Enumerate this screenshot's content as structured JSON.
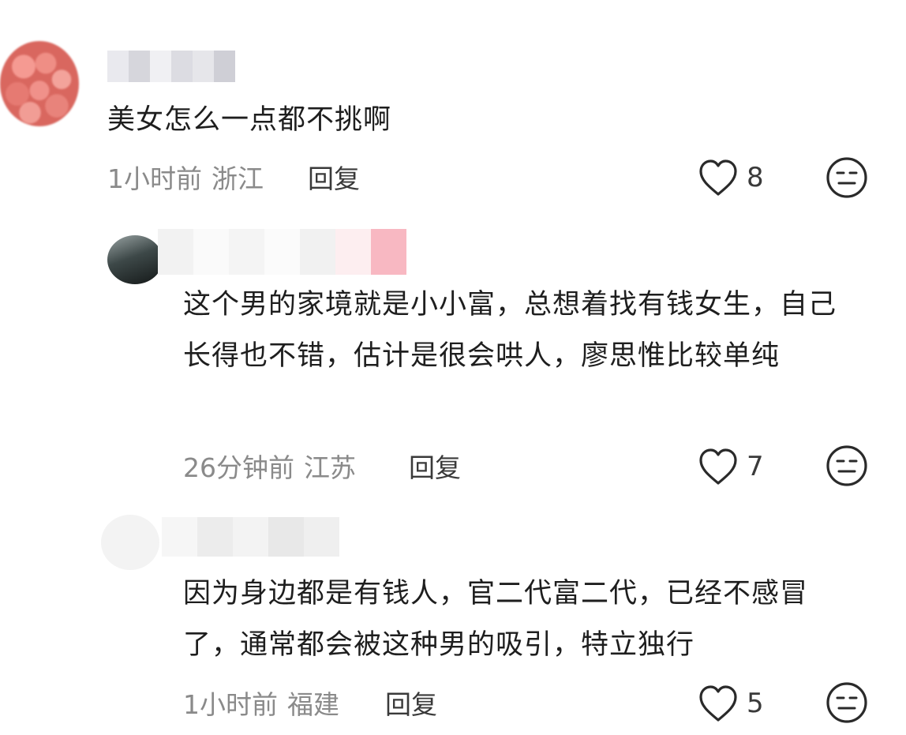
{
  "comments": [
    {
      "text": "美女怎么一点都不挑啊",
      "time": "1小时前",
      "location": "浙江",
      "reply_label": "回复",
      "likes": "8",
      "avatar_icon": "fruit-avatar-icon"
    },
    {
      "text": "这个男的家境就是小小富，总想着找有钱女生，自己长得也不错，估计是很会哄人，廖思惟比较单纯",
      "time": "26分钟前",
      "location": "江苏",
      "reply_label": "回复",
      "likes": "7",
      "avatar_icon": "dark-photo-avatar-icon"
    },
    {
      "text": "因为身边都是有钱人，官二代富二代，已经不感冒了，通常都会被这种男的吸引，特立独行",
      "time": "1小时前",
      "location": "福建",
      "reply_label": "回复",
      "likes": "5",
      "avatar_icon": "light-avatar-icon"
    }
  ],
  "icons": {
    "like": "heart-outline-icon",
    "dislike": "neutral-face-icon"
  },
  "colors": {
    "text": "#1e1e1e",
    "meta": "#8a8a8a",
    "icon": "#2a2a2a",
    "background": "#ffffff"
  }
}
